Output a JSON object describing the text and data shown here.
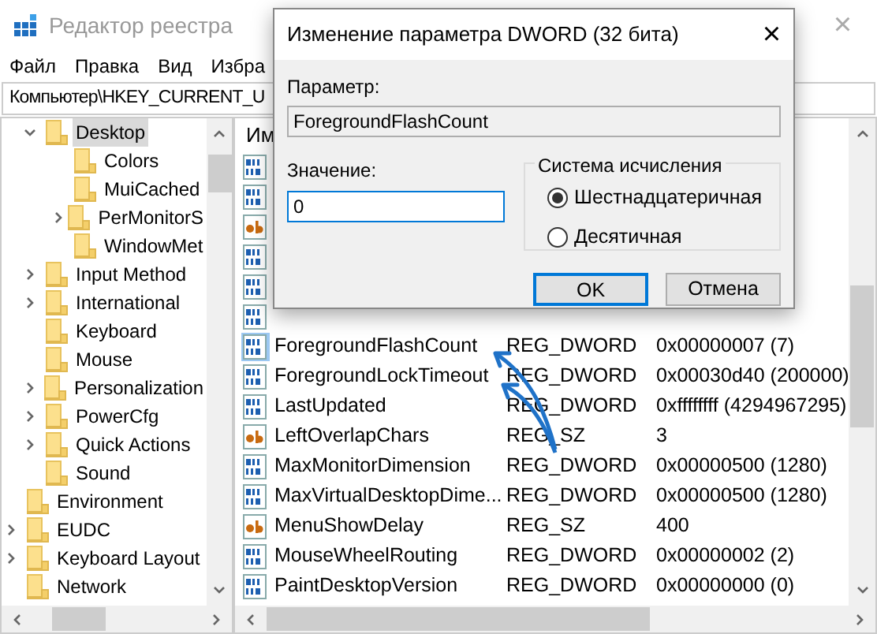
{
  "window": {
    "title": "Редактор реестра",
    "close": "×"
  },
  "menu": [
    "Файл",
    "Правка",
    "Вид",
    "Избра"
  ],
  "address": "Компьютер\\HKEY_CURRENT_U",
  "tree": {
    "scrolled_branch": [
      {
        "label": "Desktop",
        "has_children": true,
        "expanded": true,
        "selected": true,
        "children": [
          {
            "label": "Colors",
            "has_children": false,
            "selected": false
          },
          {
            "label": "MuiCached",
            "has_children": false,
            "selected": false
          },
          {
            "label": "PerMonitorS",
            "has_children": true,
            "expanded": false,
            "selected": false
          },
          {
            "label": "WindowMet",
            "has_children": false,
            "selected": false
          }
        ]
      },
      {
        "label": "Input Method",
        "has_children": true,
        "expanded": false,
        "selected": false
      },
      {
        "label": "International",
        "has_children": true,
        "expanded": false,
        "selected": false
      },
      {
        "label": "Keyboard",
        "has_children": false,
        "selected": false
      },
      {
        "label": "Mouse",
        "has_children": false,
        "selected": false
      },
      {
        "label": "Personalization",
        "has_children": true,
        "expanded": false,
        "selected": false
      },
      {
        "label": "PowerCfg",
        "has_children": true,
        "expanded": false,
        "selected": false
      },
      {
        "label": "Quick Actions",
        "has_children": true,
        "expanded": false,
        "selected": false
      },
      {
        "label": "Sound",
        "has_children": false,
        "selected": false
      }
    ],
    "items": [
      {
        "label": "Environment",
        "has_children": false,
        "selected": false
      },
      {
        "label": "EUDC",
        "has_children": true,
        "expanded": false,
        "selected": false
      },
      {
        "label": "Keyboard Layout",
        "has_children": true,
        "expanded": false,
        "selected": false
      },
      {
        "label": "Network",
        "has_children": false,
        "selected": false
      }
    ]
  },
  "values": {
    "column_1": "Им",
    "rows": [
      {
        "kind": "dword",
        "selected": false
      },
      {
        "kind": "dword",
        "selected": false
      },
      {
        "kind": "string",
        "selected": false
      },
      {
        "kind": "dword",
        "selected": false
      },
      {
        "kind": "dword",
        "selected": false
      },
      {
        "kind": "dword",
        "selected": false
      },
      {
        "kind": "dword",
        "selected": true,
        "name": "ForegroundFlashCount",
        "type": "REG_DWORD",
        "data": "0x00000007 (7)"
      },
      {
        "kind": "dword",
        "selected": false,
        "name": "ForegroundLockTimeout",
        "type": "REG_DWORD",
        "data": "0x00030d40 (200000)"
      },
      {
        "kind": "dword",
        "selected": false,
        "name": "LastUpdated",
        "type": "REG_DWORD",
        "data": "0xffffffff (4294967295)"
      },
      {
        "kind": "string",
        "selected": false,
        "name": "LeftOverlapChars",
        "type": "REG_SZ",
        "data": "3"
      },
      {
        "kind": "dword",
        "selected": false,
        "name": "MaxMonitorDimension",
        "type": "REG_DWORD",
        "data": "0x00000500 (1280)"
      },
      {
        "kind": "dword",
        "selected": false,
        "name": "MaxVirtualDesktopDime...",
        "type": "REG_DWORD",
        "data": "0x00000500 (1280)"
      },
      {
        "kind": "string",
        "selected": false,
        "name": "MenuShowDelay",
        "type": "REG_SZ",
        "data": "400"
      },
      {
        "kind": "dword",
        "selected": false,
        "name": "MouseWheelRouting",
        "type": "REG_DWORD",
        "data": "0x00000002 (2)"
      },
      {
        "kind": "dword",
        "selected": false,
        "name": "PaintDesktopVersion",
        "type": "REG_DWORD",
        "data": "0x00000000 (0)"
      }
    ]
  },
  "dialog": {
    "title": "Изменение параметра DWORD (32 бита)",
    "close": "×",
    "name_label": "Параметр:",
    "name_value": "ForegroundFlashCount",
    "value_label": "Значение:",
    "value": "0",
    "base_group": "Система исчисления",
    "bases": [
      {
        "label": "Шестнадцатеричная",
        "selected": true
      },
      {
        "label": "Десятичная",
        "selected": false
      }
    ],
    "buttons": [
      {
        "label": "OK",
        "default": true
      },
      {
        "label": "Отмена",
        "default": false
      }
    ]
  },
  "annotations": [
    {
      "kind": "arrow"
    },
    {
      "kind": "arrow"
    }
  ]
}
